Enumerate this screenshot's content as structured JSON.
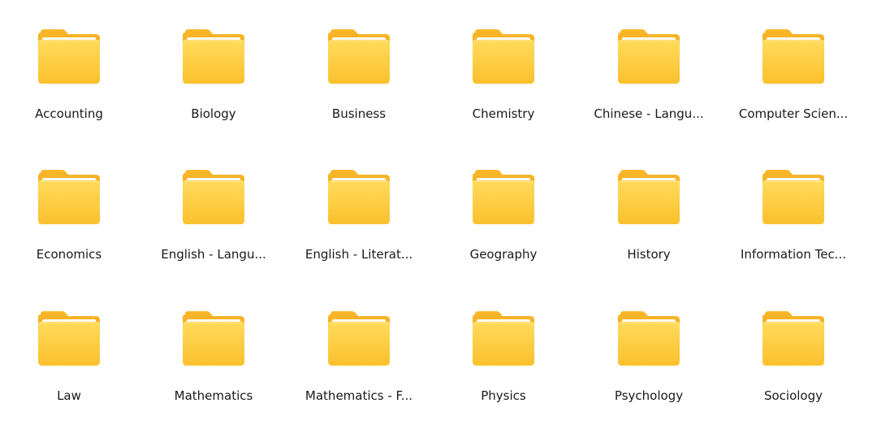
{
  "folders": [
    {
      "label": "Accounting"
    },
    {
      "label": "Biology"
    },
    {
      "label": "Business"
    },
    {
      "label": "Chemistry"
    },
    {
      "label": "Chinese - Langu..."
    },
    {
      "label": "Computer Scien..."
    },
    {
      "label": "Economics"
    },
    {
      "label": "English - Langu..."
    },
    {
      "label": "English - Literat..."
    },
    {
      "label": "Geography"
    },
    {
      "label": "History"
    },
    {
      "label": "Information Tec..."
    },
    {
      "label": "Law"
    },
    {
      "label": "Mathematics"
    },
    {
      "label": "Mathematics - F..."
    },
    {
      "label": "Physics"
    },
    {
      "label": "Psychology"
    },
    {
      "label": "Sociology"
    }
  ],
  "colors": {
    "folder_back": "#F7B52A",
    "folder_front": "#FFD54F",
    "folder_front_bottom": "#FBC531",
    "folder_sheet": "#FFFFFF"
  }
}
